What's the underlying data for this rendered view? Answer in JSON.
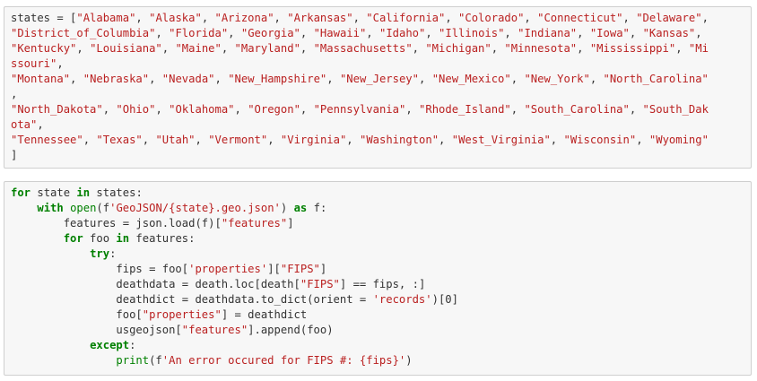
{
  "cells": [
    {
      "lines": [
        [
          [
            "var",
            "states = ["
          ],
          [
            "str",
            "\"Alabama\""
          ],
          [
            "var",
            ", "
          ],
          [
            "str",
            "\"Alaska\""
          ],
          [
            "var",
            ", "
          ],
          [
            "str",
            "\"Arizona\""
          ],
          [
            "var",
            ", "
          ],
          [
            "str",
            "\"Arkansas\""
          ],
          [
            "var",
            ", "
          ],
          [
            "str",
            "\"California\""
          ],
          [
            "var",
            ", "
          ],
          [
            "str",
            "\"Colorado\""
          ],
          [
            "var",
            ", "
          ],
          [
            "str",
            "\"Connecticut\""
          ],
          [
            "var",
            ", "
          ],
          [
            "str",
            "\"Delaware\""
          ],
          [
            "var",
            ","
          ]
        ],
        [
          [
            "str",
            "\"District_of_Columbia\""
          ],
          [
            "var",
            ", "
          ],
          [
            "str",
            "\"Florida\""
          ],
          [
            "var",
            ", "
          ],
          [
            "str",
            "\"Georgia\""
          ],
          [
            "var",
            ", "
          ],
          [
            "str",
            "\"Hawaii\""
          ],
          [
            "var",
            ", "
          ],
          [
            "str",
            "\"Idaho\""
          ],
          [
            "var",
            ", "
          ],
          [
            "str",
            "\"Illinois\""
          ],
          [
            "var",
            ", "
          ],
          [
            "str",
            "\"Indiana\""
          ],
          [
            "var",
            ", "
          ],
          [
            "str",
            "\"Iowa\""
          ],
          [
            "var",
            ", "
          ],
          [
            "str",
            "\"Kansas\""
          ],
          [
            "var",
            ","
          ]
        ],
        [
          [
            "str",
            "\"Kentucky\""
          ],
          [
            "var",
            ", "
          ],
          [
            "str",
            "\"Louisiana\""
          ],
          [
            "var",
            ", "
          ],
          [
            "str",
            "\"Maine\""
          ],
          [
            "var",
            ", "
          ],
          [
            "str",
            "\"Maryland\""
          ],
          [
            "var",
            ", "
          ],
          [
            "str",
            "\"Massachusetts\""
          ],
          [
            "var",
            ", "
          ],
          [
            "str",
            "\"Michigan\""
          ],
          [
            "var",
            ", "
          ],
          [
            "str",
            "\"Minnesota\""
          ],
          [
            "var",
            ", "
          ],
          [
            "str",
            "\"Mississippi\""
          ],
          [
            "var",
            ", "
          ],
          [
            "str",
            "\"Mi"
          ]
        ],
        [
          [
            "str",
            "ssouri\""
          ],
          [
            "var",
            ","
          ]
        ],
        [
          [
            "str",
            "\"Montana\""
          ],
          [
            "var",
            ", "
          ],
          [
            "str",
            "\"Nebraska\""
          ],
          [
            "var",
            ", "
          ],
          [
            "str",
            "\"Nevada\""
          ],
          [
            "var",
            ", "
          ],
          [
            "str",
            "\"New_Hampshire\""
          ],
          [
            "var",
            ", "
          ],
          [
            "str",
            "\"New_Jersey\""
          ],
          [
            "var",
            ", "
          ],
          [
            "str",
            "\"New_Mexico\""
          ],
          [
            "var",
            ", "
          ],
          [
            "str",
            "\"New_York\""
          ],
          [
            "var",
            ", "
          ],
          [
            "str",
            "\"North_Carolina\""
          ]
        ],
        [
          [
            "var",
            ","
          ]
        ],
        [
          [
            "str",
            "\"North_Dakota\""
          ],
          [
            "var",
            ", "
          ],
          [
            "str",
            "\"Ohio\""
          ],
          [
            "var",
            ", "
          ],
          [
            "str",
            "\"Oklahoma\""
          ],
          [
            "var",
            ", "
          ],
          [
            "str",
            "\"Oregon\""
          ],
          [
            "var",
            ", "
          ],
          [
            "str",
            "\"Pennsylvania\""
          ],
          [
            "var",
            ", "
          ],
          [
            "str",
            "\"Rhode_Island\""
          ],
          [
            "var",
            ", "
          ],
          [
            "str",
            "\"South_Carolina\""
          ],
          [
            "var",
            ", "
          ],
          [
            "str",
            "\"South_Dak"
          ]
        ],
        [
          [
            "str",
            "ota\""
          ],
          [
            "var",
            ","
          ]
        ],
        [
          [
            "str",
            "\"Tennessee\""
          ],
          [
            "var",
            ", "
          ],
          [
            "str",
            "\"Texas\""
          ],
          [
            "var",
            ", "
          ],
          [
            "str",
            "\"Utah\""
          ],
          [
            "var",
            ", "
          ],
          [
            "str",
            "\"Vermont\""
          ],
          [
            "var",
            ", "
          ],
          [
            "str",
            "\"Virginia\""
          ],
          [
            "var",
            ", "
          ],
          [
            "str",
            "\"Washington\""
          ],
          [
            "var",
            ", "
          ],
          [
            "str",
            "\"West_Virginia\""
          ],
          [
            "var",
            ", "
          ],
          [
            "str",
            "\"Wisconsin\""
          ],
          [
            "var",
            ", "
          ],
          [
            "str",
            "\"Wyoming\""
          ]
        ],
        [
          [
            "var",
            "]"
          ]
        ]
      ]
    },
    {
      "lines": [
        [
          [
            "kw",
            "for"
          ],
          [
            "var",
            " state "
          ],
          [
            "kw",
            "in"
          ],
          [
            "var",
            " states:"
          ]
        ],
        [
          [
            "var",
            "    "
          ],
          [
            "kw",
            "with"
          ],
          [
            "var",
            " "
          ],
          [
            "bi",
            "open"
          ],
          [
            "var",
            "(f"
          ],
          [
            "str",
            "'GeoJSON/{state}.geo.json'"
          ],
          [
            "var",
            ") "
          ],
          [
            "kw",
            "as"
          ],
          [
            "var",
            " f:"
          ]
        ],
        [
          [
            "var",
            "        features = json.load(f)["
          ],
          [
            "str",
            "\"features\""
          ],
          [
            "var",
            "]"
          ]
        ],
        [
          [
            "var",
            "        "
          ],
          [
            "kw",
            "for"
          ],
          [
            "var",
            " foo "
          ],
          [
            "kw",
            "in"
          ],
          [
            "var",
            " features:"
          ]
        ],
        [
          [
            "var",
            "            "
          ],
          [
            "kw",
            "try"
          ],
          [
            "var",
            ":"
          ]
        ],
        [
          [
            "var",
            "                fips = foo["
          ],
          [
            "str",
            "'properties'"
          ],
          [
            "var",
            "]["
          ],
          [
            "str",
            "\"FIPS\""
          ],
          [
            "var",
            "]"
          ]
        ],
        [
          [
            "var",
            "                deathdata = death.loc[death["
          ],
          [
            "str",
            "\"FIPS\""
          ],
          [
            "var",
            "] == fips, :]"
          ]
        ],
        [
          [
            "var",
            "                deathdict = deathdata.to_dict(orient = "
          ],
          [
            "str",
            "'records'"
          ],
          [
            "var",
            ")[0]"
          ]
        ],
        [
          [
            "var",
            "                foo["
          ],
          [
            "str",
            "\"properties\""
          ],
          [
            "var",
            "] = deathdict"
          ]
        ],
        [
          [
            "var",
            "                usgeojson["
          ],
          [
            "str",
            "\"features\""
          ],
          [
            "var",
            "].append(foo)"
          ]
        ],
        [
          [
            "var",
            "            "
          ],
          [
            "kw",
            "except"
          ],
          [
            "var",
            ":"
          ]
        ],
        [
          [
            "var",
            "                "
          ],
          [
            "bi",
            "print"
          ],
          [
            "var",
            "(f"
          ],
          [
            "str",
            "'An error occured for FIPS #: {fips}'"
          ],
          [
            "var",
            ")"
          ]
        ]
      ]
    }
  ]
}
